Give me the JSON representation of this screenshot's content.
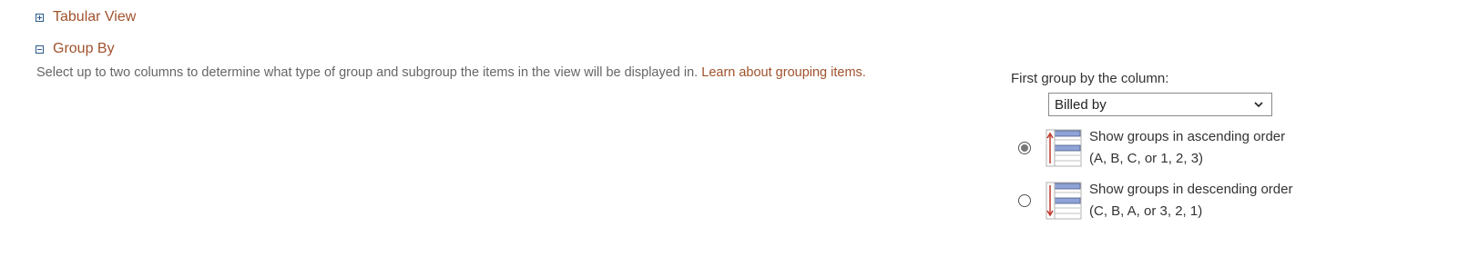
{
  "sections": {
    "tabular_view": {
      "title": "Tabular View",
      "state": "collapsed"
    },
    "group_by": {
      "title": "Group By",
      "state": "expanded"
    }
  },
  "group_by": {
    "description": "Select up to two columns to determine what type of group and subgroup the items in the view will be displayed in.",
    "learn_link": "Learn about grouping items.",
    "first_group_label": "First group by the column:",
    "selected_column": "Billed by",
    "ascending": {
      "line1": "Show groups in ascending order",
      "line2": "(A, B, C, or 1, 2, 3)",
      "checked": true
    },
    "descending": {
      "line1": "Show groups in descending order",
      "line2": "(C, B, A, or 3, 2, 1)",
      "checked": false
    }
  },
  "colors": {
    "link": "#a0522d",
    "toggle_border": "#2a5a8c",
    "icon_bar": "#8fa3d6",
    "icon_arrow": "#c0392b"
  },
  "icons": {
    "expand": "plus-box-icon",
    "collapse": "minus-box-icon",
    "ascending": "sort-ascending-icon",
    "descending": "sort-descending-icon",
    "dropdown": "chevron-down-icon"
  }
}
